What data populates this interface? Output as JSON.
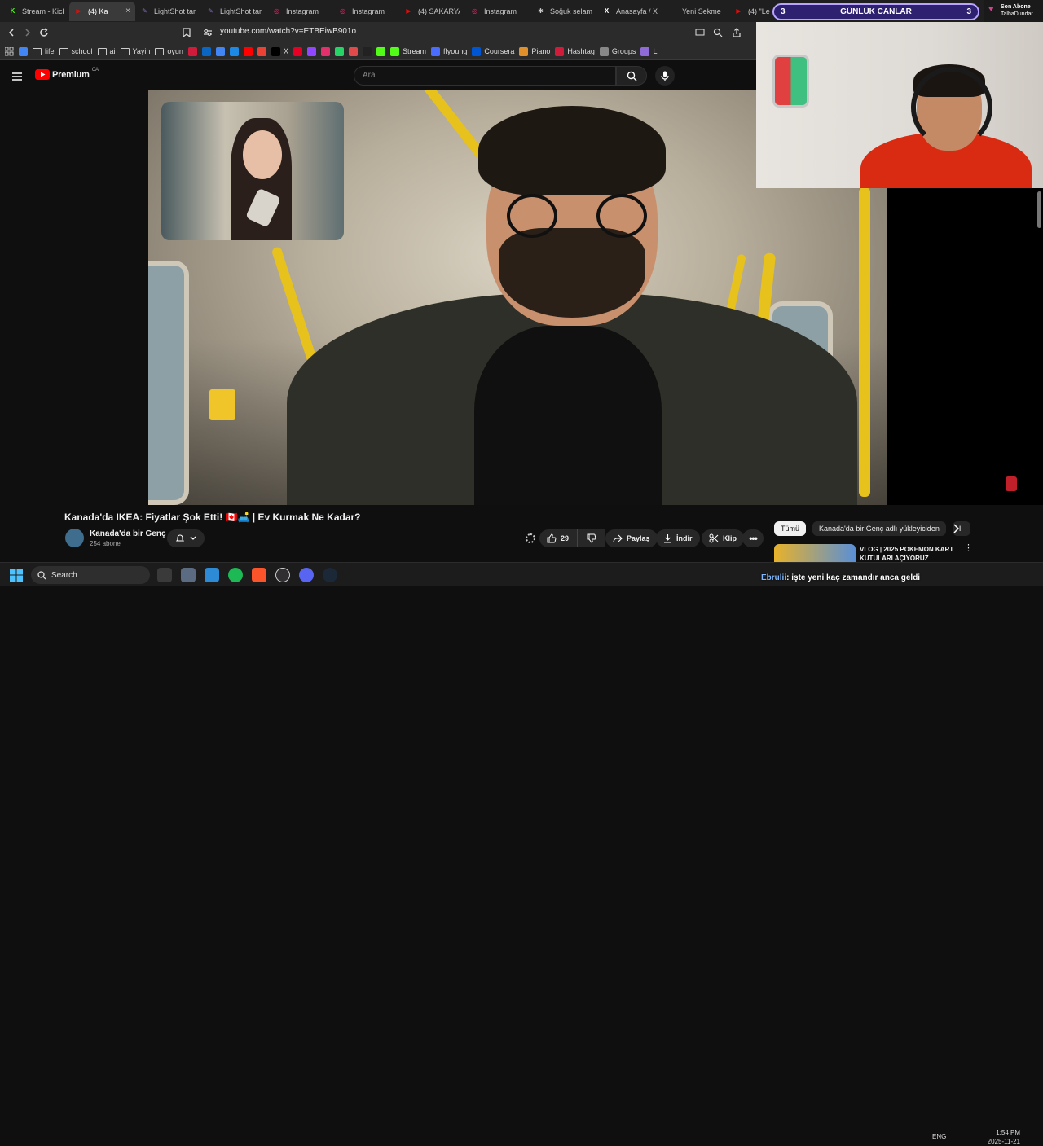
{
  "browser": {
    "tabs": [
      {
        "label": "Stream - Kick",
        "icon": "kick-icon",
        "color": "#53fc18"
      },
      {
        "label": "(4) Ka",
        "icon": "youtube-icon",
        "color": "#ff0000",
        "active": true
      },
      {
        "label": "LightShot tar",
        "icon": "feather-icon",
        "color": "#8e6bd6"
      },
      {
        "label": "LightShot tar",
        "icon": "feather-icon",
        "color": "#8e6bd6"
      },
      {
        "label": "Instagram",
        "icon": "instagram-icon",
        "color": "#e1306c"
      },
      {
        "label": "Instagram",
        "icon": "instagram-icon",
        "color": "#e1306c"
      },
      {
        "label": "(4) SAKARYA",
        "icon": "youtube-icon",
        "color": "#ff0000"
      },
      {
        "label": "Instagram",
        "icon": "instagram-icon",
        "color": "#e1306c"
      },
      {
        "label": "Soğuk selam",
        "icon": "chatgpt-icon",
        "color": "#cccccc"
      },
      {
        "label": "Anasayfa / X",
        "icon": "x-icon",
        "color": "#ffffff"
      },
      {
        "label": "Yeni Sekme",
        "icon": "newtab-icon",
        "color": "#888888"
      },
      {
        "label": "(4) \"Le",
        "icon": "youtube-icon",
        "color": "#ff0000"
      }
    ],
    "url": "youtube.com/watch?v=ETBEiwB901o",
    "bookmarks": [
      {
        "label": "",
        "icon": "google-icon",
        "color": "#4285f4"
      },
      {
        "label": "life",
        "icon": "folder-icon",
        "color": ""
      },
      {
        "label": "school",
        "icon": "folder-icon",
        "color": ""
      },
      {
        "label": "ai",
        "icon": "folder-icon",
        "color": ""
      },
      {
        "label": "Yayin",
        "icon": "folder-icon",
        "color": ""
      },
      {
        "label": "oyun",
        "icon": "folder-icon",
        "color": ""
      },
      {
        "label": "",
        "icon": "recall-icon",
        "color": "#d01c3a"
      },
      {
        "label": "",
        "icon": "linkedin-icon",
        "color": "#0a66c2"
      },
      {
        "label": "",
        "icon": "chrome-icon",
        "color": "#4285f4"
      },
      {
        "label": "",
        "icon": "edge-icon",
        "color": "#1e88e5"
      },
      {
        "label": "",
        "icon": "youtube-icon",
        "color": "#ff0000"
      },
      {
        "label": "",
        "icon": "gmail-icon",
        "color": "#ea4335"
      },
      {
        "label": "X",
        "icon": "x-icon",
        "color": "#000000"
      },
      {
        "label": "",
        "icon": "pinterest-icon",
        "color": "#e60023"
      },
      {
        "label": "",
        "icon": "twitch-icon",
        "color": "#9146ff"
      },
      {
        "label": "",
        "icon": "instagram-icon",
        "color": "#e1306c"
      },
      {
        "label": "",
        "icon": "whatsapp-icon",
        "color": "#25d366"
      },
      {
        "label": "",
        "icon": "tumblr-icon",
        "color": "#e14a4a"
      },
      {
        "label": "",
        "icon": "amazon-icon",
        "color": "#222222"
      },
      {
        "label": "",
        "icon": "kick-icon",
        "color": "#53fc18"
      },
      {
        "label": "Stream",
        "icon": "kick-icon",
        "color": "#53fc18"
      },
      {
        "label": "ffyoung",
        "icon": "ffyoung-icon",
        "color": "#4a6cff"
      },
      {
        "label": "Coursera",
        "icon": "coursera-icon",
        "color": "#0056d2"
      },
      {
        "label": "Piano",
        "icon": "piano-icon",
        "color": "#e0902a"
      },
      {
        "label": "Hashtag",
        "icon": "hashtag-icon",
        "color": "#d01c3a"
      },
      {
        "label": "Groups",
        "icon": "groups-icon",
        "color": "#888888"
      },
      {
        "label": "Li",
        "icon": "feather-icon",
        "color": "#8e6bd6"
      }
    ]
  },
  "youtube": {
    "logo_text": "Premium",
    "region": "CA",
    "search_placeholder": "Ara",
    "video_title": "Kanada'da IKEA: Fiyatlar Şok Etti! 🇨🇦🛋️ | Ev Kurmak Ne Kadar?",
    "channel_name": "Kanada'da bir Genç",
    "channel_subs": "254 abone",
    "likes": "29",
    "share_label": "Paylaş",
    "download_label": "İndir",
    "clip_label": "Klip",
    "chips": [
      "Tümü",
      "Kanada'da bir Genç adlı yükleyiciden",
      "İl"
    ],
    "recommended_title": "VLOG | 2025 POKEMON KART KUTULARI AÇIYORUZ"
  },
  "overlay": {
    "goal_left": "3",
    "goal_title": "GÜNLÜK CANLAR",
    "goal_right": "3",
    "last_sub_label": "Son Abone",
    "last_sub_name": "TalhaDundar",
    "ticker_name": "Ebrulii",
    "ticker_text": ": işte yeni kaç zamandır anca geldi"
  },
  "taskbar": {
    "search_label": "Search",
    "lang": "ENG",
    "time": "1:54 PM",
    "date": "2025-11-21"
  }
}
